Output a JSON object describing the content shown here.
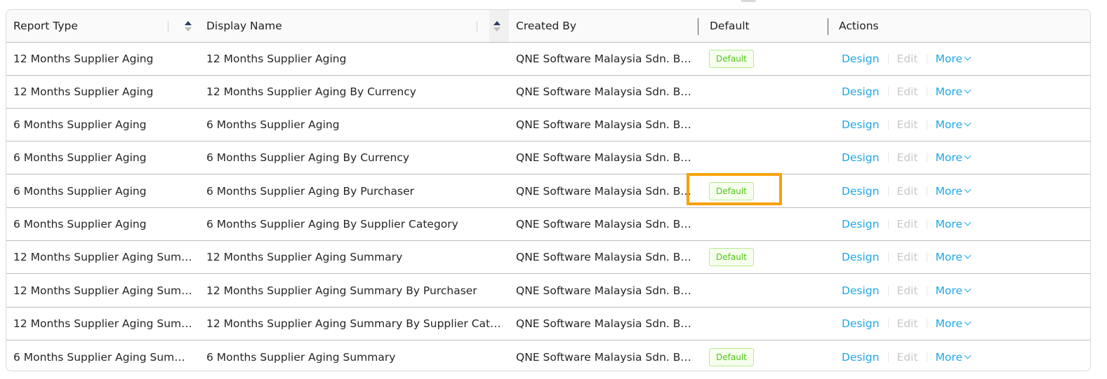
{
  "columns": {
    "report_type": "Report Type",
    "display_name": "Display Name",
    "created_by": "Created By",
    "default": "Default",
    "actions": "Actions"
  },
  "action_labels": {
    "design": "Design",
    "edit": "Edit",
    "more": "More"
  },
  "rows": [
    {
      "report_type": "12 Months Supplier Aging",
      "display_name": "12 Months Supplier Aging",
      "created_by": "QNE Software Malaysia Sdn. B…",
      "default": "Default"
    },
    {
      "report_type": "12 Months Supplier Aging",
      "display_name": "12 Months Supplier Aging By Currency",
      "created_by": "QNE Software Malaysia Sdn. B…",
      "default": ""
    },
    {
      "report_type": "6 Months Supplier Aging",
      "display_name": "6 Months Supplier Aging",
      "created_by": "QNE Software Malaysia Sdn. B…",
      "default": ""
    },
    {
      "report_type": "6 Months Supplier Aging",
      "display_name": "6 Months Supplier Aging By Currency",
      "created_by": "QNE Software Malaysia Sdn. B…",
      "default": ""
    },
    {
      "report_type": "6 Months Supplier Aging",
      "display_name": "6 Months Supplier Aging By Purchaser",
      "created_by": "QNE Software Malaysia Sdn. B…",
      "default": "Default"
    },
    {
      "report_type": "6 Months Supplier Aging",
      "display_name": "6 Months Supplier Aging By Supplier Category",
      "created_by": "QNE Software Malaysia Sdn. B…",
      "default": ""
    },
    {
      "report_type": "12 Months Supplier Aging Sum…",
      "display_name": "12 Months Supplier Aging Summary",
      "created_by": "QNE Software Malaysia Sdn. B…",
      "default": "Default"
    },
    {
      "report_type": "12 Months Supplier Aging Sum…",
      "display_name": "12 Months Supplier Aging Summary By Purchaser",
      "created_by": "QNE Software Malaysia Sdn. B…",
      "default": ""
    },
    {
      "report_type": "12 Months Supplier Aging Sum…",
      "display_name": "12 Months Supplier Aging Summary By Supplier Cat…",
      "created_by": "QNE Software Malaysia Sdn. B…",
      "default": ""
    },
    {
      "report_type": "6 Months Supplier Aging Sum…",
      "display_name": "6 Months Supplier Aging Summary",
      "created_by": "QNE Software Malaysia Sdn. B…",
      "default": "Default"
    }
  ],
  "colors": {
    "link": "#1ea7e8",
    "disabled": "#c8c8c8",
    "badge_text": "#52c41a",
    "badge_bg": "#f6ffed",
    "highlight": "#f7a10c"
  }
}
